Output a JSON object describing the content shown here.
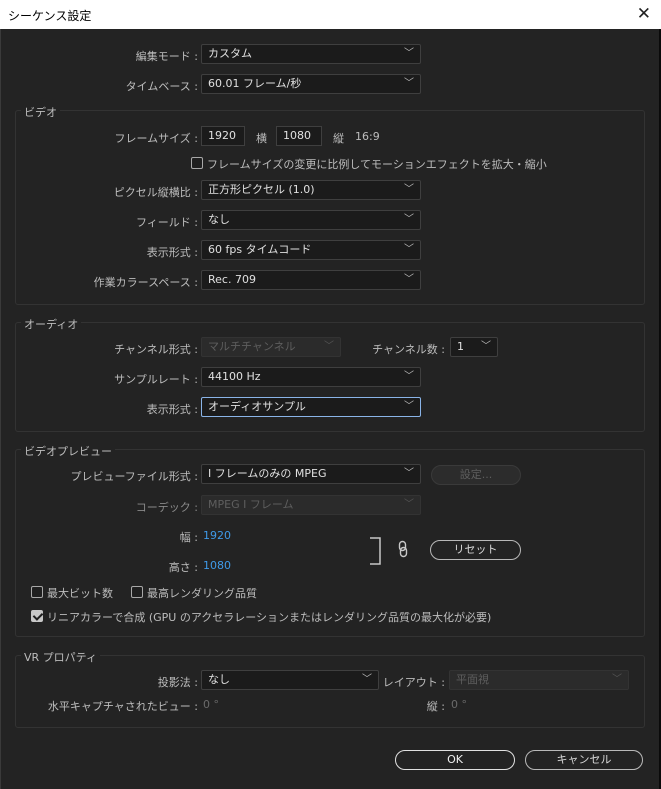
{
  "window": {
    "title": "シーケンス設定"
  },
  "general": {
    "edit_mode_label": "編集モード :",
    "edit_mode_value": "カスタム",
    "timebase_label": "タイムベース :",
    "timebase_value": "60.01 フレーム/秒"
  },
  "video": {
    "title": "ビデオ",
    "frame_size_label": "フレームサイズ :",
    "width_value": "1920",
    "width_unit": "横",
    "height_value": "1080",
    "height_unit": "縦",
    "aspect": "16:9",
    "scale_checkbox_label": "フレームサイズの変更に比例してモーションエフェクトを拡大・縮小",
    "pixel_aspect_label": "ピクセル縦横比 :",
    "pixel_aspect_value": "正方形ピクセル (1.0)",
    "fields_label": "フィールド :",
    "fields_value": "なし",
    "display_format_label": "表示形式 :",
    "display_format_value": "60 fps タイムコード",
    "color_space_label": "作業カラースペース :",
    "color_space_value": "Rec. 709"
  },
  "audio": {
    "title": "オーディオ",
    "channel_format_label": "チャンネル形式 :",
    "channel_format_value": "マルチチャンネル",
    "channel_count_label": "チャンネル数 :",
    "channel_count_value": "1",
    "sample_rate_label": "サンプルレート :",
    "sample_rate_value": "44100 Hz",
    "display_format_label": "表示形式 :",
    "display_format_value": "オーディオサンプル"
  },
  "preview": {
    "title": "ビデオプレビュー",
    "file_format_label": "プレビューファイル形式 :",
    "file_format_value": "I フレームのみの MPEG",
    "settings_button": "設定...",
    "codec_label": "コーデック :",
    "codec_value": "MPEG I フレーム",
    "width_label": "幅 :",
    "width_value": "1920",
    "height_label": "高さ :",
    "height_value": "1080",
    "reset_button": "リセット",
    "max_bit_depth_label": "最大ビット数",
    "max_render_quality_label": "最高レンダリング品質",
    "linear_color_label": "リニアカラーで合成 (GPU のアクセラレーションまたはレンダリング品質の最大化が必要)"
  },
  "vr": {
    "title": "VR プロパティ",
    "projection_label": "投影法 :",
    "projection_value": "なし",
    "layout_label": "レイアウト :",
    "layout_value": "平面視",
    "horizontal_capture_label": "水平キャプチャされたビュー :",
    "horizontal_capture_value": "0 °",
    "vertical_label": "縦 :",
    "vertical_value": "0 °"
  },
  "footer": {
    "ok_button": "OK",
    "cancel_button": "キャンセル"
  },
  "icons": {
    "close": "close-icon",
    "dropdown": "chevron-down-icon",
    "link": "chain-link-icon"
  }
}
